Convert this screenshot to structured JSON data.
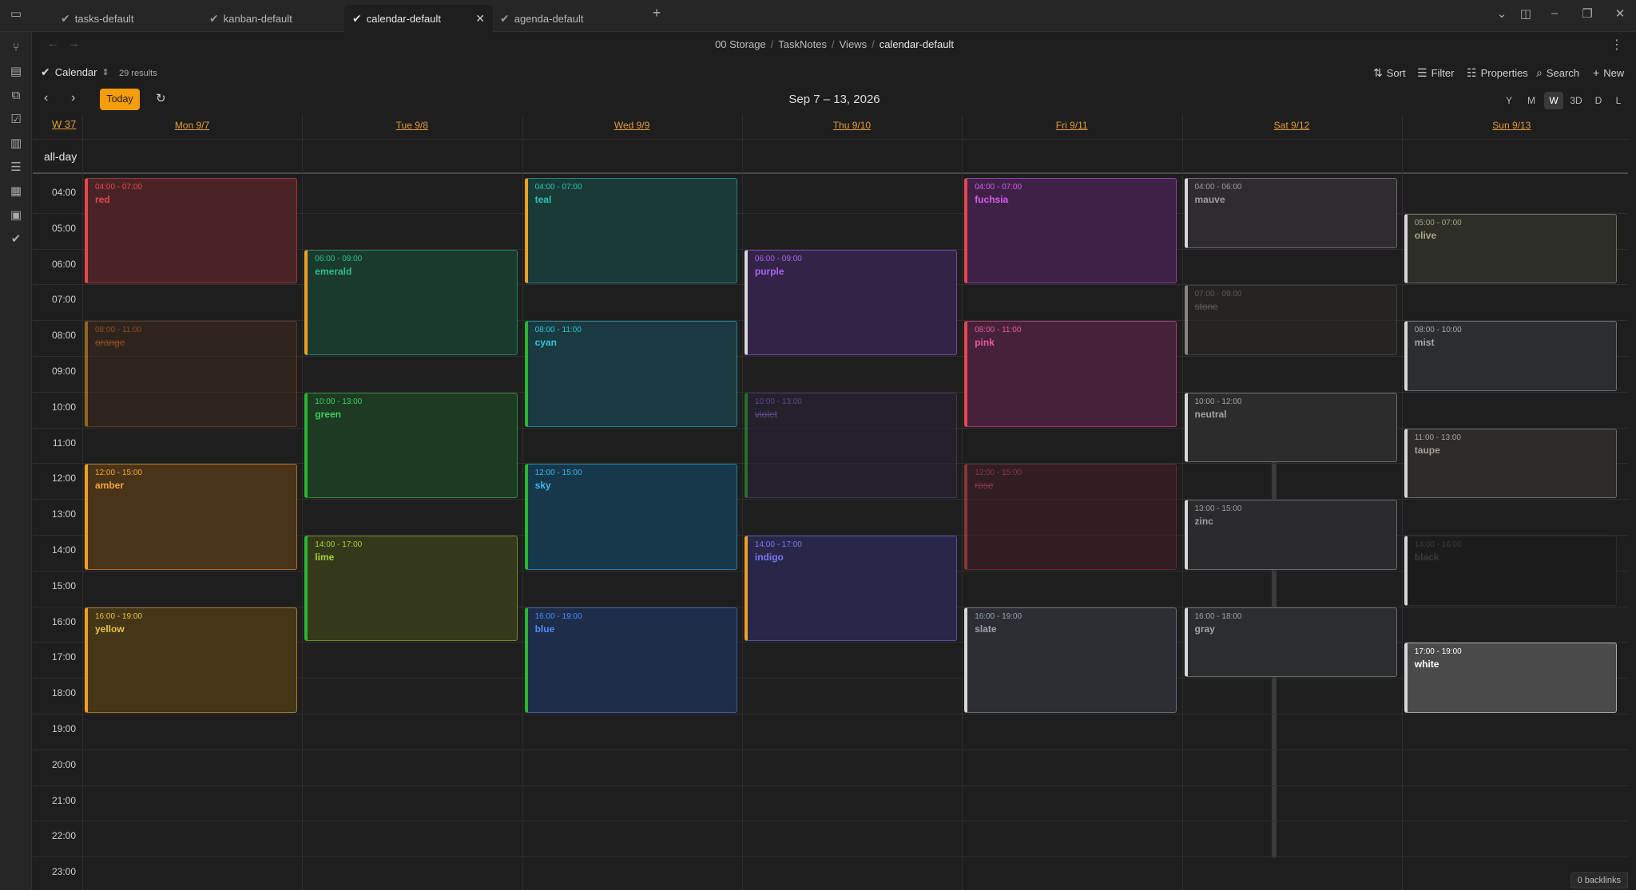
{
  "tabs": [
    {
      "label": "tasks-default",
      "active": false
    },
    {
      "label": "kanban-default",
      "active": false
    },
    {
      "label": "calendar-default",
      "active": true
    },
    {
      "label": "agenda-default",
      "active": false
    }
  ],
  "breadcrumb": [
    "00 Storage",
    "TaskNotes",
    "Views",
    "calendar-default"
  ],
  "toolbar": {
    "view_label": "Calendar",
    "results": "29 results",
    "sort": "Sort",
    "filter": "Filter",
    "properties": "Properties",
    "search": "Search",
    "new": "New"
  },
  "calendar": {
    "today_label": "Today",
    "range_title": "Sep 7 – 13, 2026",
    "views": [
      "Y",
      "M",
      "W",
      "3D",
      "D",
      "L"
    ],
    "selected_view": "W",
    "week_label": "W 37",
    "allday_label": "all-day",
    "days": [
      "Mon 9/7",
      "Tue 9/8",
      "Wed 9/9",
      "Thu 9/10",
      "Fri 9/11",
      "Sat 9/12",
      "Sun 9/13"
    ],
    "hours": [
      "04:00",
      "05:00",
      "06:00",
      "07:00",
      "08:00",
      "09:00",
      "10:00",
      "11:00",
      "12:00",
      "13:00",
      "14:00",
      "15:00",
      "16:00",
      "17:00",
      "18:00",
      "19:00",
      "20:00",
      "21:00",
      "22:00",
      "23:00"
    ],
    "events": [
      {
        "day": 0,
        "start": 4,
        "end": 7,
        "time": "04:00 - 07:00",
        "title": "red",
        "color": "#e5484d",
        "accent": "#e5484d",
        "bg": "#4a2326",
        "done": false
      },
      {
        "day": 0,
        "start": 8,
        "end": 11,
        "time": "08:00 - 11:00",
        "title": "orange",
        "color": "#e0742f",
        "accent": "#f0a020",
        "bg": "#3d2a1d",
        "done": true
      },
      {
        "day": 0,
        "start": 12,
        "end": 15,
        "time": "12:00 - 15:00",
        "title": "amber",
        "color": "#f0a63a",
        "accent": "#f0a020",
        "bg": "#4a3419",
        "done": false
      },
      {
        "day": 0,
        "start": 16,
        "end": 19,
        "time": "16:00 - 19:00",
        "title": "yellow",
        "color": "#e8c24a",
        "accent": "#f0a020",
        "bg": "#443617",
        "done": false
      },
      {
        "day": 1,
        "start": 6,
        "end": 9,
        "time": "06:00 - 09:00",
        "title": "emerald",
        "color": "#2fbf86",
        "accent": "#f0a020",
        "bg": "#1b3a2e",
        "done": false
      },
      {
        "day": 1,
        "start": 10,
        "end": 13,
        "time": "10:00 - 13:00",
        "title": "green",
        "color": "#3fcf5a",
        "accent": "#28b830",
        "bg": "#1d3a23",
        "done": false
      },
      {
        "day": 1,
        "start": 14,
        "end": 17,
        "time": "14:00 - 17:00",
        "title": "lime",
        "color": "#a8d23a",
        "accent": "#28b830",
        "bg": "#33391a",
        "done": false
      },
      {
        "day": 2,
        "start": 4,
        "end": 7,
        "time": "04:00 - 07:00",
        "title": "teal",
        "color": "#2fc3b6",
        "accent": "#f0a020",
        "bg": "#193a37",
        "done": false
      },
      {
        "day": 2,
        "start": 8,
        "end": 11,
        "time": "08:00 - 11:00",
        "title": "cyan",
        "color": "#35c3d8",
        "accent": "#28b830",
        "bg": "#183a40",
        "done": false
      },
      {
        "day": 2,
        "start": 12,
        "end": 15,
        "time": "12:00 - 15:00",
        "title": "sky",
        "color": "#3eb6ef",
        "accent": "#28b830",
        "bg": "#17384a",
        "done": false
      },
      {
        "day": 2,
        "start": 16,
        "end": 19,
        "time": "16:00 - 19:00",
        "title": "blue",
        "color": "#4f8cf5",
        "accent": "#28b830",
        "bg": "#1d2d4a",
        "done": false
      },
      {
        "day": 3,
        "start": 6,
        "end": 9,
        "time": "06:00 - 09:00",
        "title": "purple",
        "color": "#b062f0",
        "accent": "#d8d8d8",
        "bg": "#322447",
        "done": false
      },
      {
        "day": 3,
        "start": 10,
        "end": 13,
        "time": "10:00 - 13:00",
        "title": "violet",
        "color": "#9b6be8",
        "accent": "#28b830",
        "bg": "#2a2238",
        "done": true
      },
      {
        "day": 3,
        "start": 14,
        "end": 17,
        "time": "14:00 - 17:00",
        "title": "indigo",
        "color": "#7b78f0",
        "accent": "#f0a020",
        "bg": "#282749",
        "done": false
      },
      {
        "day": 4,
        "start": 4,
        "end": 7,
        "time": "04:00 - 07:00",
        "title": "fuchsia",
        "color": "#d55ee8",
        "accent": "#e5484d",
        "bg": "#3f2147",
        "done": false
      },
      {
        "day": 4,
        "start": 8,
        "end": 11,
        "time": "08:00 - 11:00",
        "title": "pink",
        "color": "#ee5a9a",
        "accent": "#e5484d",
        "bg": "#46223a",
        "done": false
      },
      {
        "day": 4,
        "start": 12,
        "end": 15,
        "time": "12:00 - 15:00",
        "title": "rose",
        "color": "#e84a6a",
        "accent": "#e5484d",
        "bg": "#3f1f28",
        "done": true
      },
      {
        "day": 4,
        "start": 16,
        "end": 19,
        "time": "16:00 - 19:00",
        "title": "slate",
        "color": "#9aa3b0",
        "accent": "#d8d8d8",
        "bg": "#2c2e33",
        "done": false
      },
      {
        "day": 5,
        "start": 4,
        "end": 6,
        "time": "04:00 - 06:00",
        "title": "mauve",
        "color": "#a59aa6",
        "accent": "#d8d8d8",
        "bg": "#2e2c2f",
        "done": false
      },
      {
        "day": 5,
        "start": 7,
        "end": 9,
        "time": "07:00 - 09:00",
        "title": "stone",
        "color": "#8e8a84",
        "accent": "#d8d8d8",
        "bg": "#2b2a28",
        "done": true
      },
      {
        "day": 5,
        "start": 10,
        "end": 12,
        "time": "10:00 - 12:00",
        "title": "neutral",
        "color": "#a3a3a3",
        "accent": "#d8d8d8",
        "bg": "#2c2c2c",
        "done": false
      },
      {
        "day": 5,
        "start": 13,
        "end": 15,
        "time": "13:00 - 15:00",
        "title": "zinc",
        "color": "#9c9ca4",
        "accent": "#d8d8d8",
        "bg": "#2b2b2e",
        "done": false
      },
      {
        "day": 5,
        "start": 16,
        "end": 18,
        "time": "16:00 - 18:00",
        "title": "gray",
        "color": "#a0a3a8",
        "accent": "#d8d8d8",
        "bg": "#2c2d2f",
        "done": false
      },
      {
        "day": 6,
        "start": 5,
        "end": 7,
        "time": "05:00 - 07:00",
        "title": "olive",
        "color": "#a8a686",
        "accent": "#d8d8d8",
        "bg": "#2e2e28",
        "done": false
      },
      {
        "day": 6,
        "start": 8,
        "end": 10,
        "time": "08:00 - 10:00",
        "title": "mist",
        "color": "#a6aaae",
        "accent": "#d8d8d8",
        "bg": "#2c2d2e",
        "done": false
      },
      {
        "day": 6,
        "start": 11,
        "end": 13,
        "time": "11:00 - 13:00",
        "title": "taupe",
        "color": "#a69e96",
        "accent": "#d8d8d8",
        "bg": "#2e2c2b",
        "done": false
      },
      {
        "day": 6,
        "start": 14,
        "end": 16,
        "time": "14:00 - 16:00",
        "title": "black",
        "color": "#3a3a3a",
        "accent": "#d8d8d8",
        "bg": "#1c1c1c",
        "done": false
      },
      {
        "day": 6,
        "start": 17,
        "end": 19,
        "time": "17:00 - 19:00",
        "title": "white",
        "color": "#ffffff",
        "accent": "#d8d8d8",
        "bg": "#4a4a4a",
        "done": false
      }
    ]
  },
  "status": {
    "backlinks": "0 backlinks"
  }
}
